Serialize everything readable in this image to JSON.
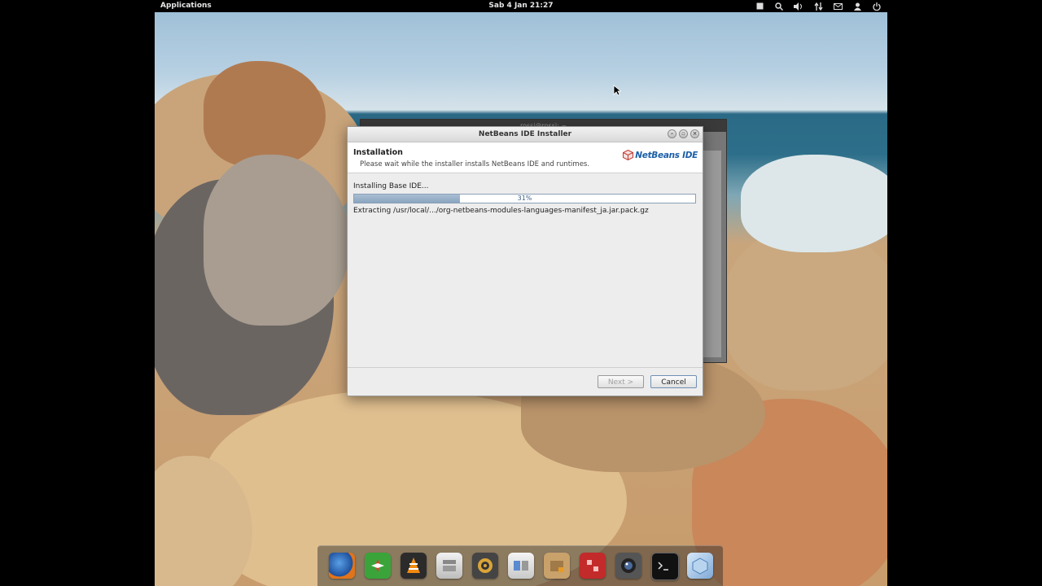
{
  "top_panel": {
    "applications_label": "Applications",
    "clock": "Sab  4 Jan 21:27",
    "indicators": [
      "window-icon",
      "search-icon",
      "volume-icon",
      "network-icon",
      "mail-icon",
      "user-icon",
      "power-icon"
    ]
  },
  "background_window": {
    "title": "rossi@rossi: ~"
  },
  "installer": {
    "title": "NetBeans IDE Installer",
    "header_title": "Installation",
    "header_desc": "Please wait while the installer installs NetBeans IDE and runtimes.",
    "logo_text": "NetBeans IDE",
    "status": "Installing Base IDE...",
    "progress_text": "31%",
    "progress_value": 0.31,
    "detail": "Extracting /usr/local/.../org-netbeans-modules-languages-manifest_ja.jar.pack.gz",
    "next_label": "Next >",
    "cancel_label": "Cancel"
  },
  "dock": {
    "items": [
      "firefox-icon",
      "compass-icon",
      "vlc-icon",
      "file-manager-icon",
      "music-player-icon",
      "system-settings-icon",
      "archive-manager-icon",
      "app-center-icon",
      "camera-icon",
      "terminal-icon",
      "virtualbox-icon"
    ]
  },
  "colors": {
    "panel": "#000000",
    "progress_fill": "#9bb3cb",
    "accent": "#1b5fa8"
  }
}
